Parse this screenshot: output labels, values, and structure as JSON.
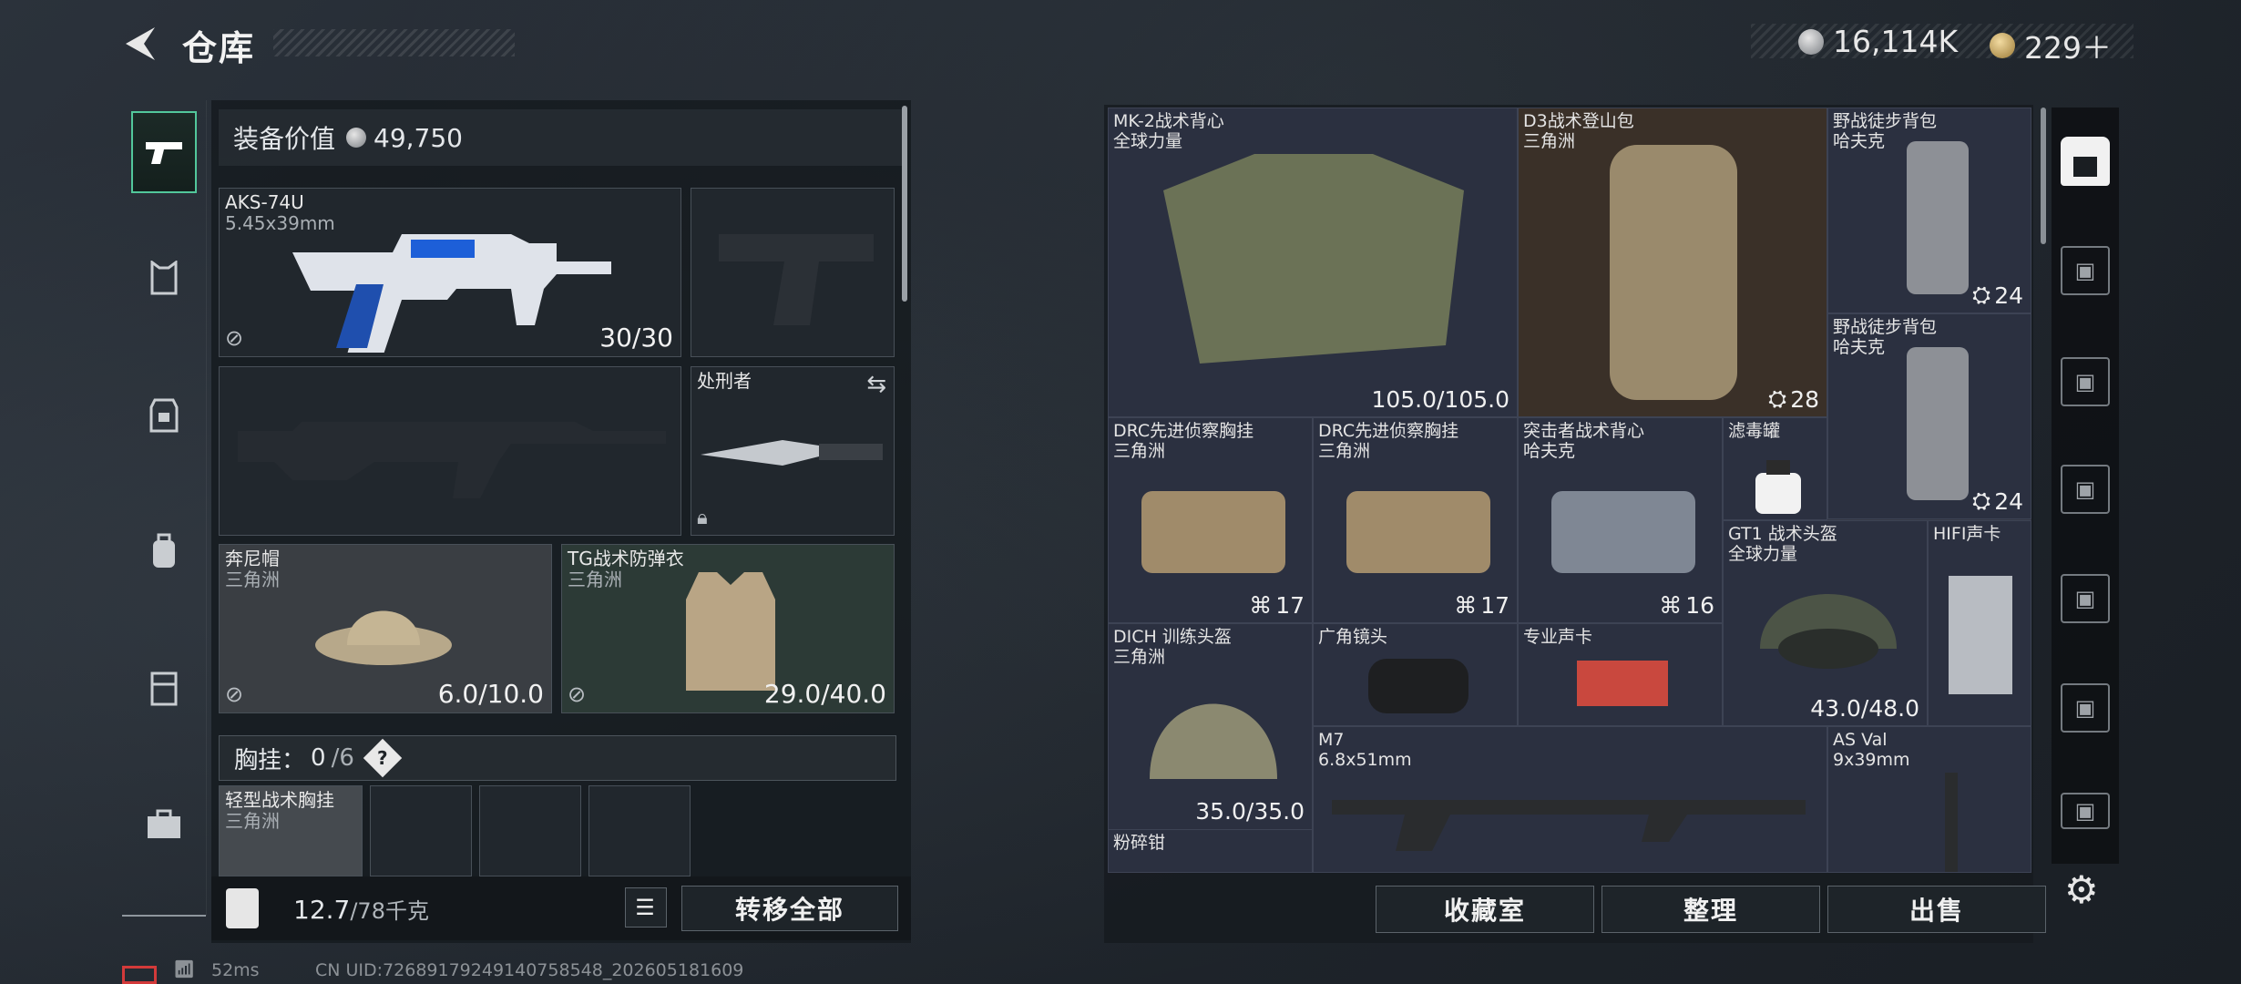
{
  "header": {
    "title": "仓库"
  },
  "currency": {
    "silver": "16,114K",
    "gold": "229＋"
  },
  "left": {
    "value_label": "装备价值",
    "value": "49,750",
    "weapon_main": {
      "name": "AKS-74U",
      "ammo": "5.45x39mm",
      "durability": "30/30"
    },
    "melee": {
      "name": "处刑者"
    },
    "hat": {
      "name": "奔尼帽",
      "faction": "三角洲",
      "durability": "6.0/10.0"
    },
    "armor": {
      "name": "TG战术防弹衣",
      "faction": "三角洲",
      "durability": "29.0/40.0"
    },
    "chest_rig": {
      "label": "胸挂：",
      "used": "0",
      "capacity": "/6",
      "help": "?"
    },
    "chest_item": {
      "name": "轻型战术胸挂",
      "faction": "三角洲"
    },
    "capacity": {
      "value": "12.7",
      "max": "/78千克"
    },
    "transfer_label": "转移全部"
  },
  "right": {
    "items": [
      {
        "name": "MK-2战术背心",
        "faction": "全球力量",
        "value": "105.0/105.0"
      },
      {
        "name": "D3战术登山包",
        "faction": "三角洲",
        "value": "28"
      },
      {
        "name": "野战徒步背包",
        "faction": "哈夫克",
        "value": "24"
      },
      {
        "name": "野战徒步背包",
        "faction": "哈夫克",
        "value": "24"
      },
      {
        "name": "DRC先进侦察胸挂",
        "faction": "三角洲",
        "value": "17"
      },
      {
        "name": "DRC先进侦察胸挂",
        "faction": "三角洲",
        "value": "17"
      },
      {
        "name": "突击者战术背心",
        "faction": "哈夫克",
        "value": "16"
      },
      {
        "name": "滤毒罐",
        "faction": "",
        "value": ""
      },
      {
        "name": "GT1 战术头盔",
        "faction": "全球力量",
        "value": "43.0/48.0"
      },
      {
        "name": "HIFI声卡",
        "faction": "",
        "value": ""
      },
      {
        "name": "DICH 训练头盔",
        "faction": "三角洲",
        "value": "35.0/35.0"
      },
      {
        "name": "广角镜头",
        "faction": "",
        "value": ""
      },
      {
        "name": "专业声卡",
        "faction": "",
        "value": ""
      },
      {
        "name": "M7",
        "faction": "6.8x51mm",
        "value": ""
      },
      {
        "name": "AS Val",
        "faction": "9x39mm",
        "value": ""
      },
      {
        "name": "粉碎钳",
        "faction": "",
        "value": ""
      }
    ],
    "buttons": {
      "collection": "收藏室",
      "sort": "整理",
      "sell": "出售"
    }
  },
  "footer": {
    "ping": "52ms",
    "uid": "CN UID:72689179249140758548_202605181609"
  },
  "colors": {
    "accent": "#52c79b",
    "panel": "#272b38"
  }
}
